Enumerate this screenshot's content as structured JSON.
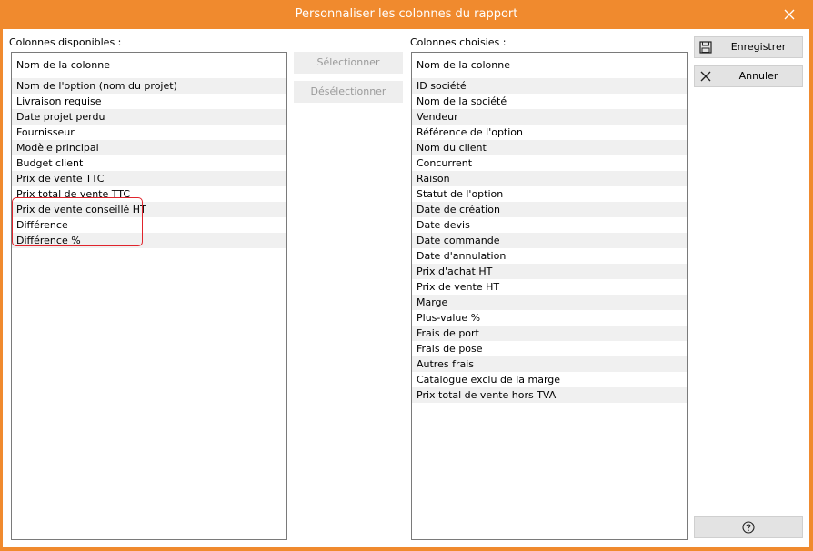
{
  "window": {
    "title": "Personnaliser les colonnes du rapport"
  },
  "available": {
    "label": "Colonnes disponibles :",
    "header": "Nom de la colonne",
    "items": [
      "Nom de l'option (nom du projet)",
      "Livraison requise",
      "Date projet perdu",
      "Fournisseur",
      "Modèle principal",
      "Budget client",
      "Prix de vente TTC",
      "Prix total de vente TTC",
      "Prix de vente conseillé HT",
      "Différence",
      "Différence %"
    ]
  },
  "buttons": {
    "select": "Sélectionner",
    "deselect": "Désélectionner",
    "save": "Enregistrer",
    "cancel": "Annuler"
  },
  "chosen": {
    "label": "Colonnes choisies :",
    "header": "Nom de la colonne",
    "items": [
      "ID société",
      "Nom de la société",
      "Vendeur",
      "Référence de l'option",
      "Nom du client",
      "Concurrent",
      "Raison",
      "Statut de l'option",
      "Date de création",
      "Date devis",
      "Date commande",
      "Date d'annulation",
      "Prix d'achat HT",
      "Prix de vente HT",
      "Marge",
      "Plus-value %",
      "Frais de port",
      "Frais de pose",
      "Autres frais",
      "Catalogue exclu de la marge",
      "Prix total de vente hors TVA"
    ]
  },
  "icons": {
    "close": "close-icon",
    "save": "floppy-disk-icon",
    "cancel": "close-icon",
    "help": "help-icon"
  },
  "colors": {
    "accent": "#f08a2e",
    "highlight": "#e0242c"
  }
}
